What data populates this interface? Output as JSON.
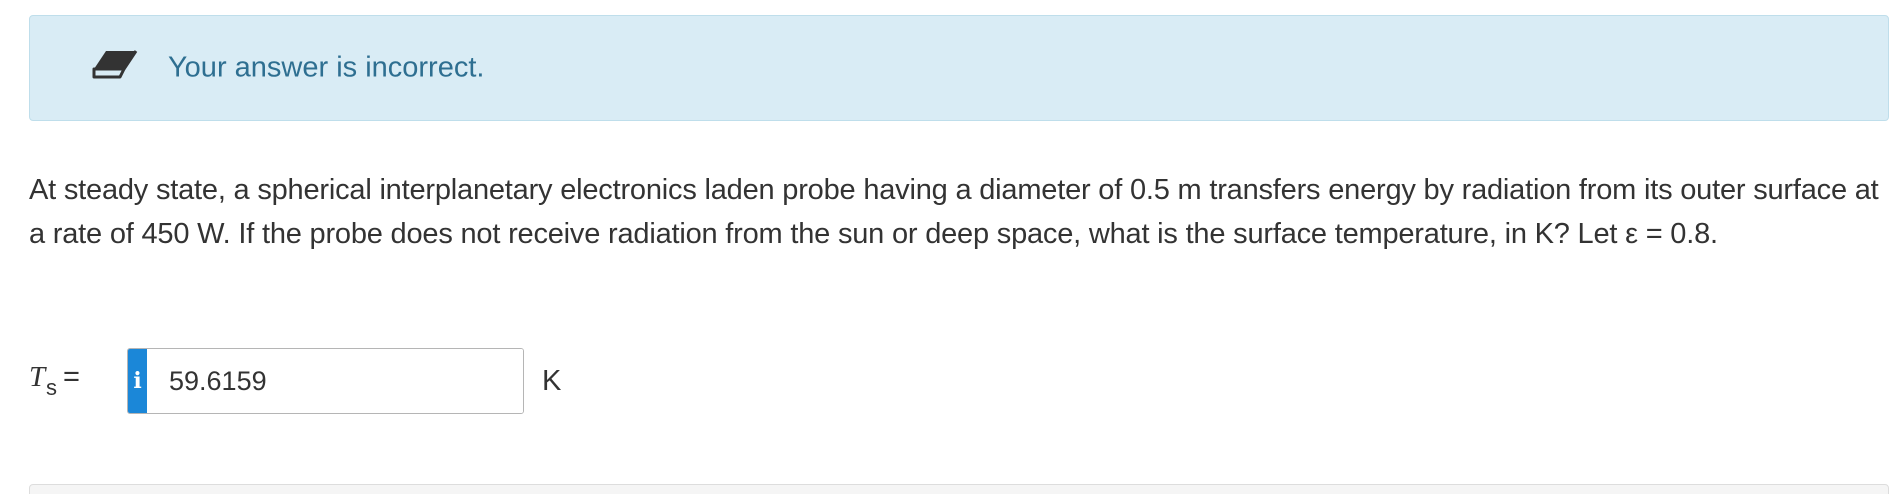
{
  "feedback": {
    "icon": "eraser-icon",
    "message": "Your answer is incorrect.",
    "background_color": "#d9ecf5",
    "text_color": "#2e6f91"
  },
  "question": {
    "text": "At steady state, a spherical interplanetary electronics laden probe having a diameter of 0.5 m transfers energy by radiation from its outer surface at a rate of 450 W. If the probe does not receive radiation from the sun or deep space, what is the surface temperature, in K? Let ε = 0.8."
  },
  "answer": {
    "variable_symbol": "T",
    "variable_subscript": "s",
    "equals": "=",
    "info_icon": "info-icon",
    "info_glyph": "i",
    "info_color": "#1b87d8",
    "value": "59.6159",
    "unit": "K"
  }
}
